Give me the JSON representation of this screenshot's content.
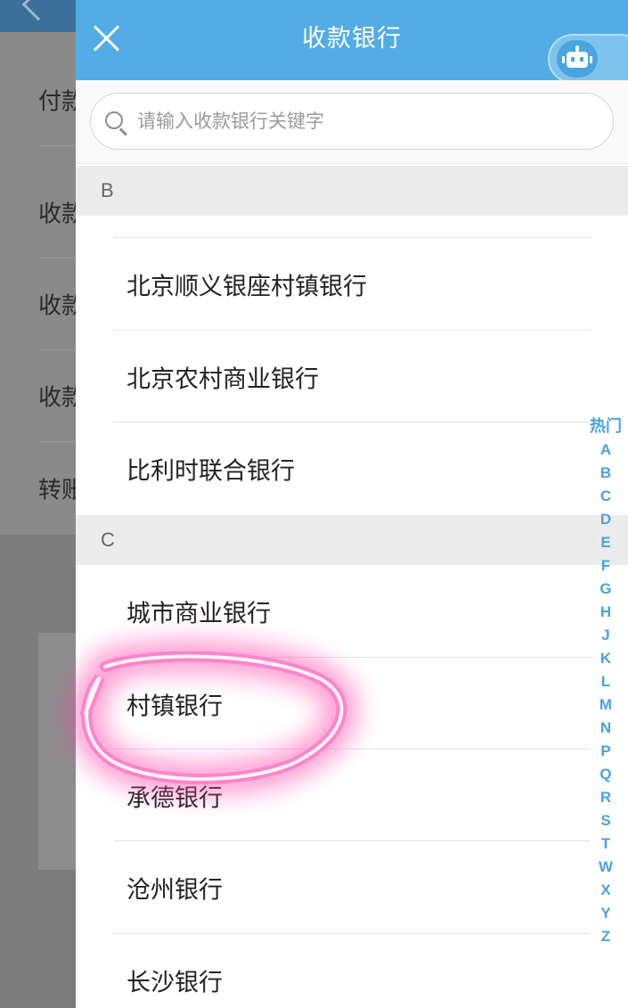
{
  "header": {
    "title": "收款银行"
  },
  "search": {
    "placeholder": "请输入收款银行关键字",
    "value": ""
  },
  "background": {
    "rows": [
      "付款",
      "收款",
      "收款",
      "收款",
      "转账"
    ]
  },
  "sections": [
    {
      "letter": "B",
      "items": [
        "北京顺义银座村镇银行",
        "北京农村商业银行",
        "比利时联合银行"
      ]
    },
    {
      "letter": "C",
      "items": [
        "城市商业银行",
        "村镇银行",
        "承德银行",
        "沧州银行",
        "长沙银行"
      ]
    }
  ],
  "index_bar": [
    "热门",
    "A",
    "B",
    "C",
    "D",
    "E",
    "F",
    "G",
    "H",
    "J",
    "K",
    "L",
    "M",
    "N",
    "P",
    "Q",
    "R",
    "S",
    "T",
    "W",
    "X",
    "Y",
    "Z"
  ],
  "colors": {
    "header_bg": "#53ace6",
    "index_text": "#4aa3e0",
    "highlight": "#ff4fb0"
  }
}
